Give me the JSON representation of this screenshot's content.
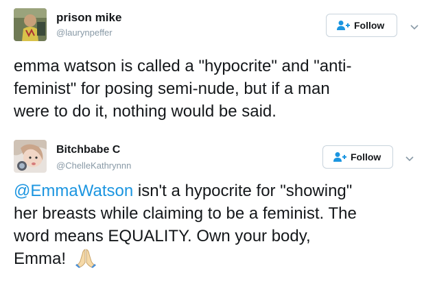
{
  "tweets": [
    {
      "display_name": "prison mike",
      "handle": "@laurynpeffer",
      "follow_label": "Follow",
      "text": "emma watson is called a \"hypocrite\" and \"anti-\nfeminist\" for posing semi-nude, but if a man\nwere to do it, nothing would be said."
    },
    {
      "display_name": "Bitchbabe C",
      "handle": "@ChelleKathrynnn",
      "follow_label": "Follow",
      "mention": "@EmmaWatson",
      "text": " isn't a hypocrite for \"showing\"\nher breasts while claiming to be a feminist. The\nword means EQUALITY. Own your body,\nEmma! ",
      "emoji": "folded-hands-emoji"
    }
  ],
  "colors": {
    "text": "#14171a",
    "handle": "#8899a6",
    "link": "#1b95e0",
    "follow_icon": "#1b95e0",
    "button_border": "#c8d3dc"
  },
  "icons": {
    "follow": "add-user-icon",
    "caret": "chevron-down-icon"
  }
}
